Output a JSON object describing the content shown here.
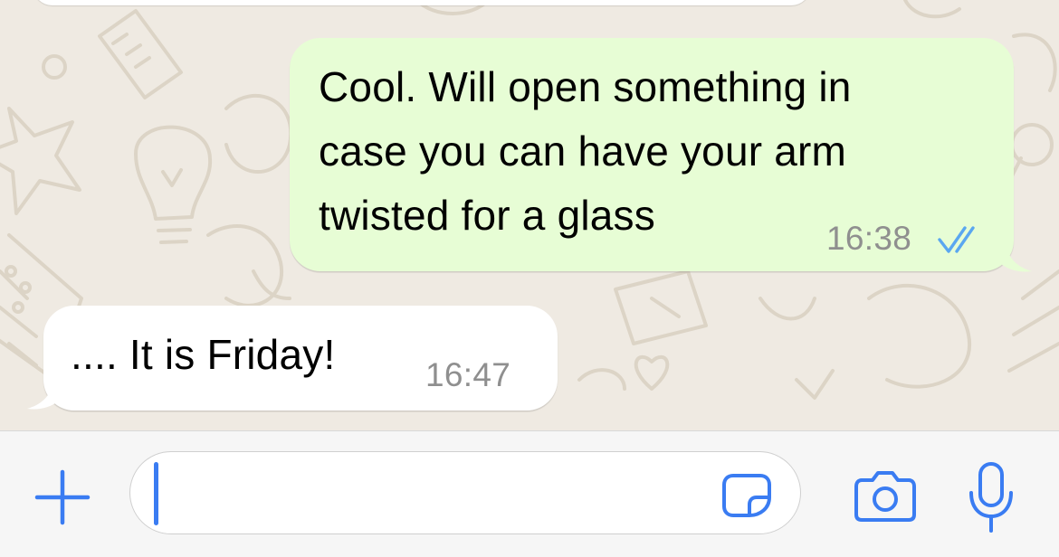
{
  "chat": {
    "messages": [
      {
        "direction": "outgoing",
        "text": "Cool. Will open something in\ncase you can have your arm\ntwisted for a glass",
        "time": "16:38",
        "status": "read",
        "status_icon": "double-check-icon"
      },
      {
        "direction": "incoming",
        "text": ".... It is Friday!",
        "time": "16:47"
      }
    ]
  },
  "composer": {
    "value": "",
    "placeholder": "",
    "icons": {
      "attach": "plus-icon",
      "sticker": "sticker-icon",
      "camera": "camera-icon",
      "voice": "microphone-icon"
    }
  },
  "colors": {
    "wallpaper": "#efeae2",
    "outgoing_bubble": "#e7fdd5",
    "incoming_bubble": "#ffffff",
    "accent": "#3a7cf2",
    "timestamp": "#8f8f8f",
    "read_ticks": "#5aa7f0",
    "input_bar": "#f6f6f6"
  }
}
